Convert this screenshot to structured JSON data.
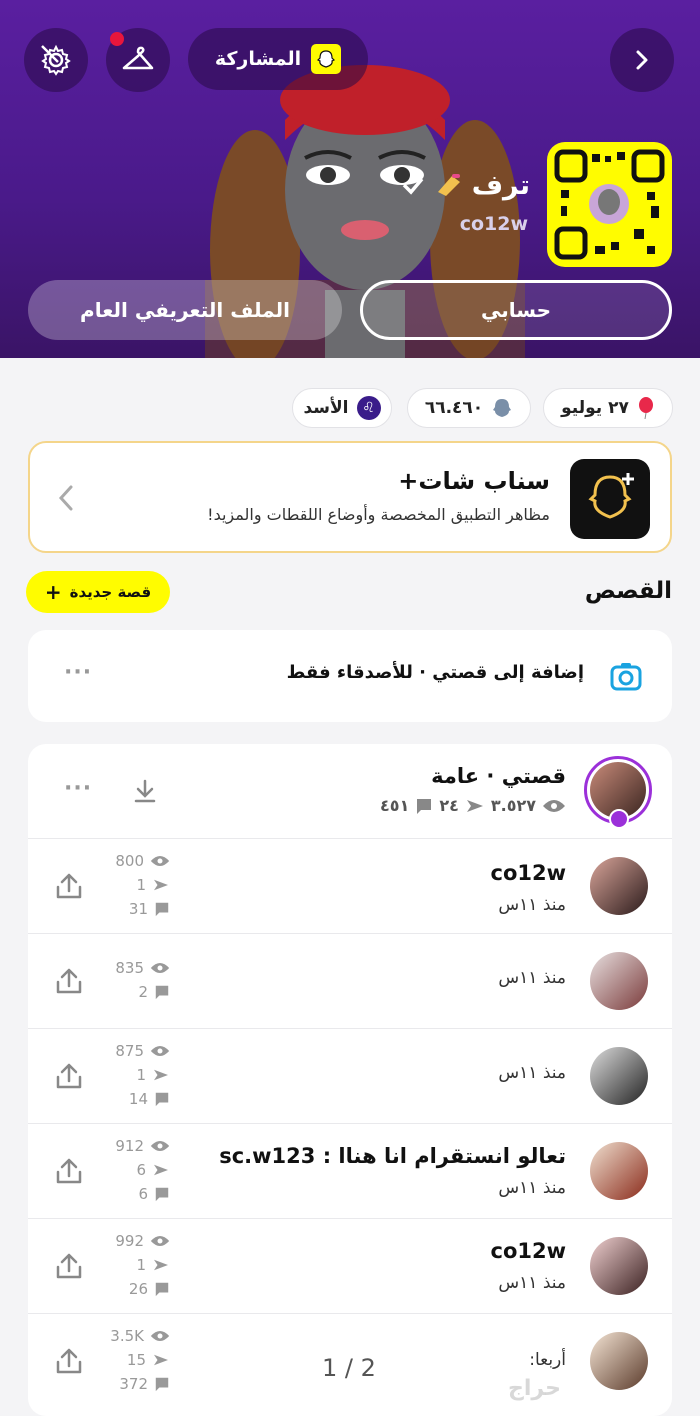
{
  "header": {
    "share_label": "المشاركة",
    "name": "ترف",
    "username": "co12w",
    "tabs": [
      {
        "label": "حسابي",
        "active": true
      },
      {
        "label": "الملف التعريفي العام",
        "active": false
      }
    ],
    "accent": "#5a1fa0"
  },
  "chips": {
    "birthday": "٢٧ يوليو",
    "score": "٦٦.٤٦٠",
    "zodiac": "الأسد"
  },
  "snapchat_plus": {
    "title": "سناب شات+",
    "subtitle": "مظاهر التطبيق المخصصة وأوضاع اللقطات والمزيد!"
  },
  "stories": {
    "title": "القصص",
    "new_story_label": "قصة جديدة",
    "friends_only_label": "إضافة إلى قصتي · للأصدقاء فقط",
    "my_story": {
      "title": "قصتي · عامة",
      "views": "٣.٥٢٧",
      "screenshots": "٢٤",
      "replies": "٤٥١"
    },
    "items": [
      {
        "title": "co12w",
        "time": "منذ ١١س",
        "views": "800",
        "shares": "1",
        "replies": "31"
      },
      {
        "title": "",
        "time": "منذ ١١س",
        "views": "835",
        "shares": "",
        "replies": "2"
      },
      {
        "title": "",
        "time": "منذ ١١س",
        "views": "875",
        "shares": "1",
        "replies": "14"
      },
      {
        "title": "تعالو انستقرام انا هناا : sc.w123",
        "time": "منذ ١١س",
        "views": "912",
        "shares": "6",
        "replies": "6"
      },
      {
        "title": "co12w",
        "time": "منذ ١١س",
        "views": "992",
        "shares": "1",
        "replies": "26"
      },
      {
        "title": "",
        "time": "أربعا:",
        "views": "3.5K",
        "shares": "15",
        "replies": "372"
      }
    ]
  },
  "page_indicator": "1 / 2",
  "watermark": "حراج"
}
